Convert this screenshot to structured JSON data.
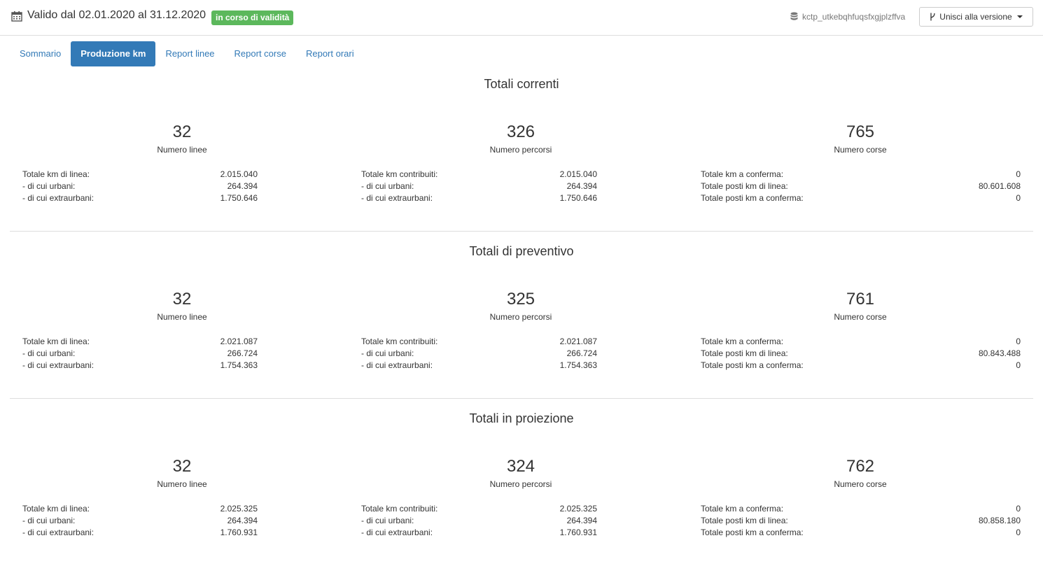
{
  "header": {
    "validity": "Valido dal 02.01.2020 al 31.12.2020",
    "badge": "in corso di validità",
    "database": "kctp_utkebqhfuqsfxgjplzffva",
    "merge_button": "Unisci alla versione",
    "badge_color": "#5cb85c"
  },
  "tabs": [
    {
      "label": "Sommario",
      "active": false
    },
    {
      "label": "Produzione km",
      "active": true
    },
    {
      "label": "Report linee",
      "active": false
    },
    {
      "label": "Report corse",
      "active": false
    },
    {
      "label": "Report orari",
      "active": false
    }
  ],
  "sections": [
    {
      "title": "Totali correnti",
      "linee": {
        "value": "32",
        "label": "Numero linee",
        "rows": [
          [
            "Totale km di linea:",
            "2.015.040"
          ],
          [
            "- di cui urbani:",
            "264.394"
          ],
          [
            "- di cui extraurbani:",
            "1.750.646"
          ]
        ]
      },
      "percorsi": {
        "value": "326",
        "label": "Numero percorsi",
        "rows": [
          [
            "Totale km contribuiti:",
            "2.015.040"
          ],
          [
            "- di cui urbani:",
            "264.394"
          ],
          [
            "- di cui extraurbani:",
            "1.750.646"
          ]
        ]
      },
      "corse": {
        "value": "765",
        "label": "Numero corse",
        "rows": [
          [
            "Totale km a conferma:",
            "0"
          ],
          [
            "Totale posti km di linea:",
            "80.601.608"
          ],
          [
            "Totale posti km a conferma:",
            "0"
          ]
        ]
      }
    },
    {
      "title": "Totali di preventivo",
      "linee": {
        "value": "32",
        "label": "Numero linee",
        "rows": [
          [
            "Totale km di linea:",
            "2.021.087"
          ],
          [
            "- di cui urbani:",
            "266.724"
          ],
          [
            "- di cui extraurbani:",
            "1.754.363"
          ]
        ]
      },
      "percorsi": {
        "value": "325",
        "label": "Numero percorsi",
        "rows": [
          [
            "Totale km contribuiti:",
            "2.021.087"
          ],
          [
            "- di cui urbani:",
            "266.724"
          ],
          [
            "- di cui extraurbani:",
            "1.754.363"
          ]
        ]
      },
      "corse": {
        "value": "761",
        "label": "Numero corse",
        "rows": [
          [
            "Totale km a conferma:",
            "0"
          ],
          [
            "Totale posti km di linea:",
            "80.843.488"
          ],
          [
            "Totale posti km a conferma:",
            "0"
          ]
        ]
      }
    },
    {
      "title": "Totali in proiezione",
      "linee": {
        "value": "32",
        "label": "Numero linee",
        "rows": [
          [
            "Totale km di linea:",
            "2.025.325"
          ],
          [
            "- di cui urbani:",
            "264.394"
          ],
          [
            "- di cui extraurbani:",
            "1.760.931"
          ]
        ]
      },
      "percorsi": {
        "value": "324",
        "label": "Numero percorsi",
        "rows": [
          [
            "Totale km contribuiti:",
            "2.025.325"
          ],
          [
            "- di cui urbani:",
            "264.394"
          ],
          [
            "- di cui extraurbani:",
            "1.760.931"
          ]
        ]
      },
      "corse": {
        "value": "762",
        "label": "Numero corse",
        "rows": [
          [
            "Totale km a conferma:",
            "0"
          ],
          [
            "Totale posti km di linea:",
            "80.858.180"
          ],
          [
            "Totale posti km a conferma:",
            "0"
          ]
        ]
      }
    }
  ]
}
